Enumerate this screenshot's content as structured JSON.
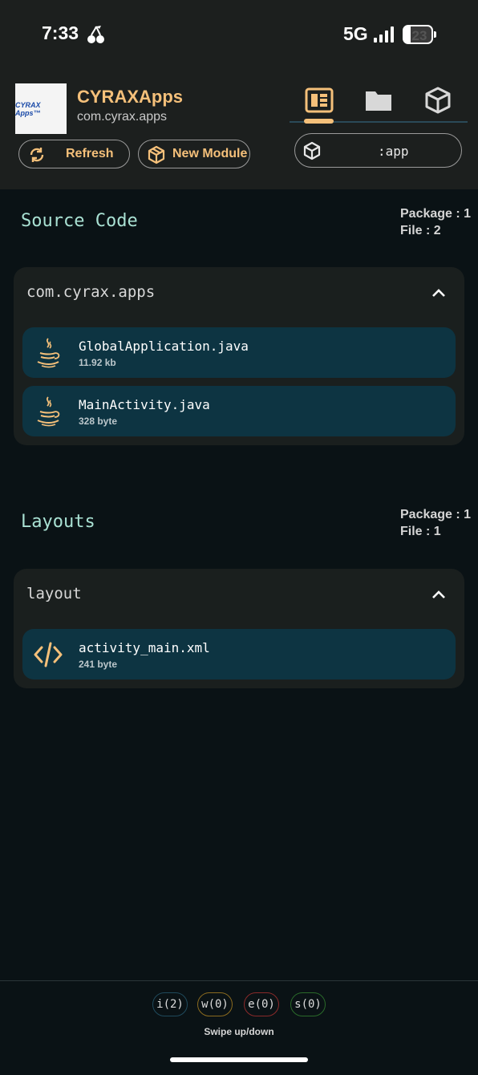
{
  "status_bar": {
    "time": "7:33",
    "network": "5G",
    "battery": "23",
    "battery_level": 0.23,
    "icons": [
      "cherry-icon",
      "signal-icon",
      "battery-icon"
    ]
  },
  "app": {
    "logo_text": "CYRAX Apps™",
    "name": "CYRAXApps",
    "package": "com.cyrax.apps"
  },
  "header": {
    "tabs": [
      {
        "icon": "source-view-icon",
        "active": true
      },
      {
        "icon": "folder-icon",
        "active": false
      },
      {
        "icon": "module-box-icon",
        "active": false
      }
    ],
    "refresh_label": "Refresh",
    "new_module_label": "New Module",
    "module_select": ":app"
  },
  "sections": [
    {
      "title": "Source Code",
      "package_stat": "Package : 1",
      "file_stat": "File : 2",
      "groups": [
        {
          "name": "com.cyrax.apps",
          "files": [
            {
              "name": "GlobalApplication.java",
              "size": "11.92 kb",
              "icon": "java-icon"
            },
            {
              "name": "MainActivity.java",
              "size": "328 byte",
              "icon": "java-icon"
            }
          ]
        }
      ]
    },
    {
      "title": "Layouts",
      "package_stat": "Package : 1",
      "file_stat": "File : 1",
      "groups": [
        {
          "name": "layout",
          "files": [
            {
              "name": "activity_main.xml",
              "size": "241 byte",
              "icon": "code-tag-icon"
            }
          ]
        }
      ]
    }
  ],
  "footer": {
    "logs": [
      {
        "label": "i(2)",
        "color": "#1f4a5c"
      },
      {
        "label": "w(0)",
        "color": "#8a6a1f"
      },
      {
        "label": "e(0)",
        "color": "#8a2a2a"
      },
      {
        "label": "s(0)",
        "color": "#2a6a2a"
      }
    ],
    "hint": "Swipe up/down"
  },
  "colors": {
    "accent": "#f5c07a",
    "section_title": "#a9e1d3",
    "file_item_bg": "#0d3442",
    "card_bg": "#1a1f1e",
    "page_bg": "#0a1215"
  }
}
